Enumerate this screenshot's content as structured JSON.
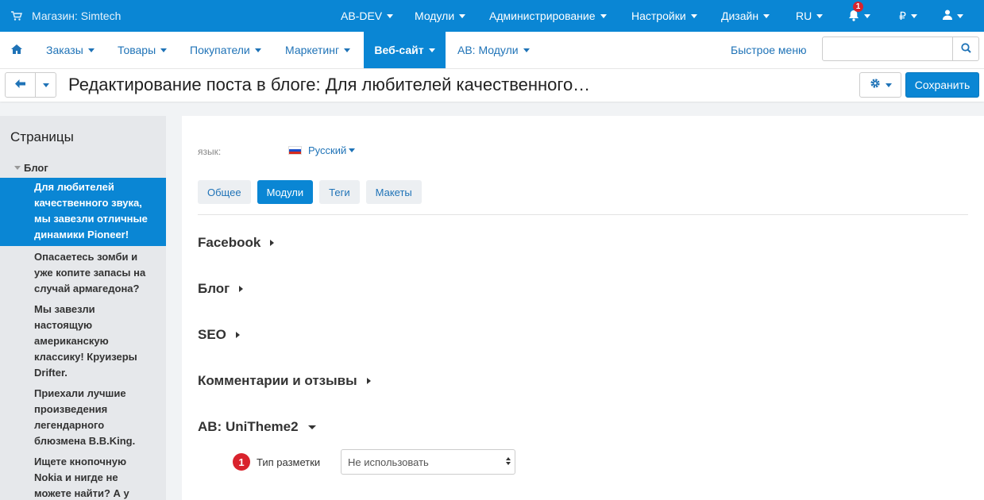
{
  "topbar": {
    "store": "Магазин: Simtech",
    "items": [
      "AB-DEV",
      "Модули",
      "Администрирование",
      "Настройки",
      "Дизайн",
      "RU"
    ],
    "notification_count": "1",
    "currency": "₽",
    "color": "#0a86d4"
  },
  "nav": {
    "items": [
      "Заказы",
      "Товары",
      "Покупатели",
      "Маркетинг",
      "Веб-сайт",
      "AB: Модули"
    ],
    "active": "Веб-сайт",
    "quick_menu": "Быстрое меню",
    "search_placeholder": ""
  },
  "titlebar": {
    "title": "Редактирование поста в блоге: Для любителей качественного…",
    "save_label": "Сохранить"
  },
  "sidebar": {
    "title": "Страницы",
    "group": "Блог",
    "posts": [
      "Для любителей качественного звука, мы завезли отличные динамики Pioneer!",
      "Опасаетесь зомби и уже копите запасы на случай армагедона?",
      "Мы завезли настоящую американскую классику! Круизеры Drifter.",
      "Приехали лучшие произведения легендарного блюзмена B.B.King.",
      "Ищете кнопочную Nokia и нигде не можете найти? А у"
    ]
  },
  "content": {
    "lang_label": "язык:",
    "lang_value": "Русский",
    "tabs": [
      "Общее",
      "Модули",
      "Теги",
      "Макеты"
    ],
    "active_tab": "Модули",
    "sections": [
      "Facebook",
      "Блог",
      "SEO",
      "Комментарии и отзывы",
      "AB: UniTheme2"
    ],
    "expanded_section": "AB: UniTheme2",
    "field": {
      "number": "1",
      "label": "Тип разметки",
      "value": "Не использовать"
    }
  }
}
